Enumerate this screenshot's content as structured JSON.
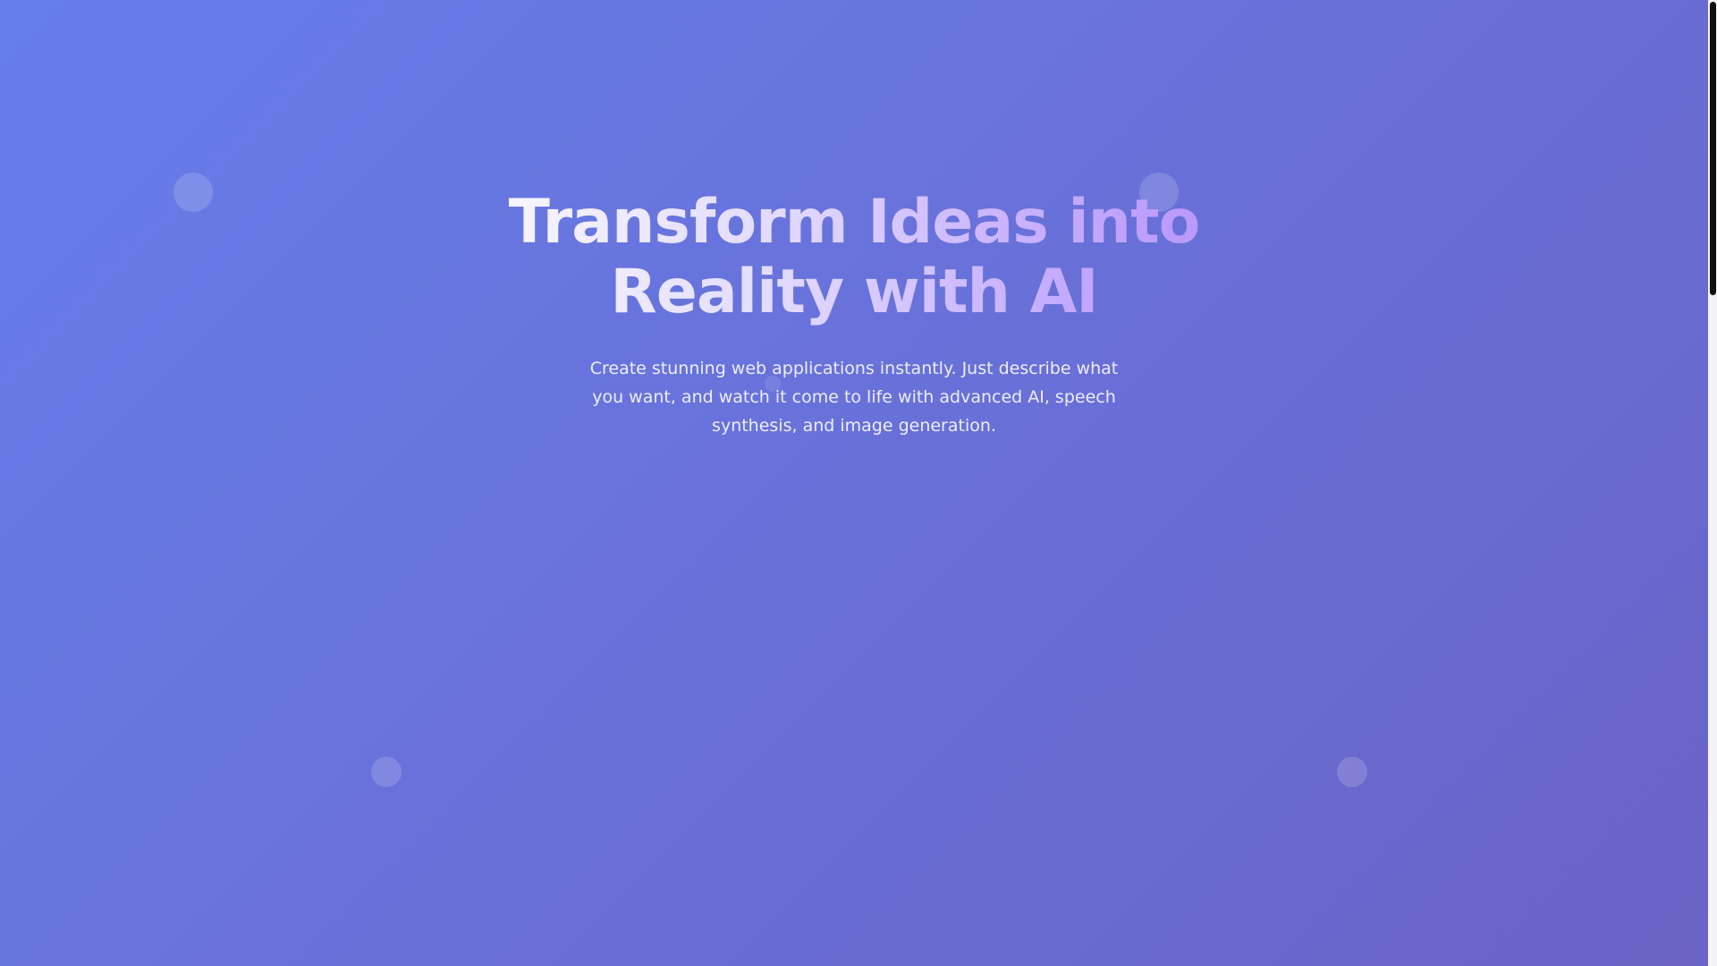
{
  "hero": {
    "title": "Transform Ideas into Reality with AI",
    "subtitle": "Create stunning web applications instantly. Just describe what you want, and watch it come to life with advanced AI, speech synthesis, and image generation."
  },
  "colors": {
    "background_start": "#667eea",
    "background_end": "#6b63c6",
    "title_gradient_end": "#b18cf5"
  },
  "decor": {
    "bubbles": [
      "circle-decoration",
      "circle-decoration",
      "circle-decoration",
      "circle-decoration",
      "circle-decoration"
    ]
  }
}
